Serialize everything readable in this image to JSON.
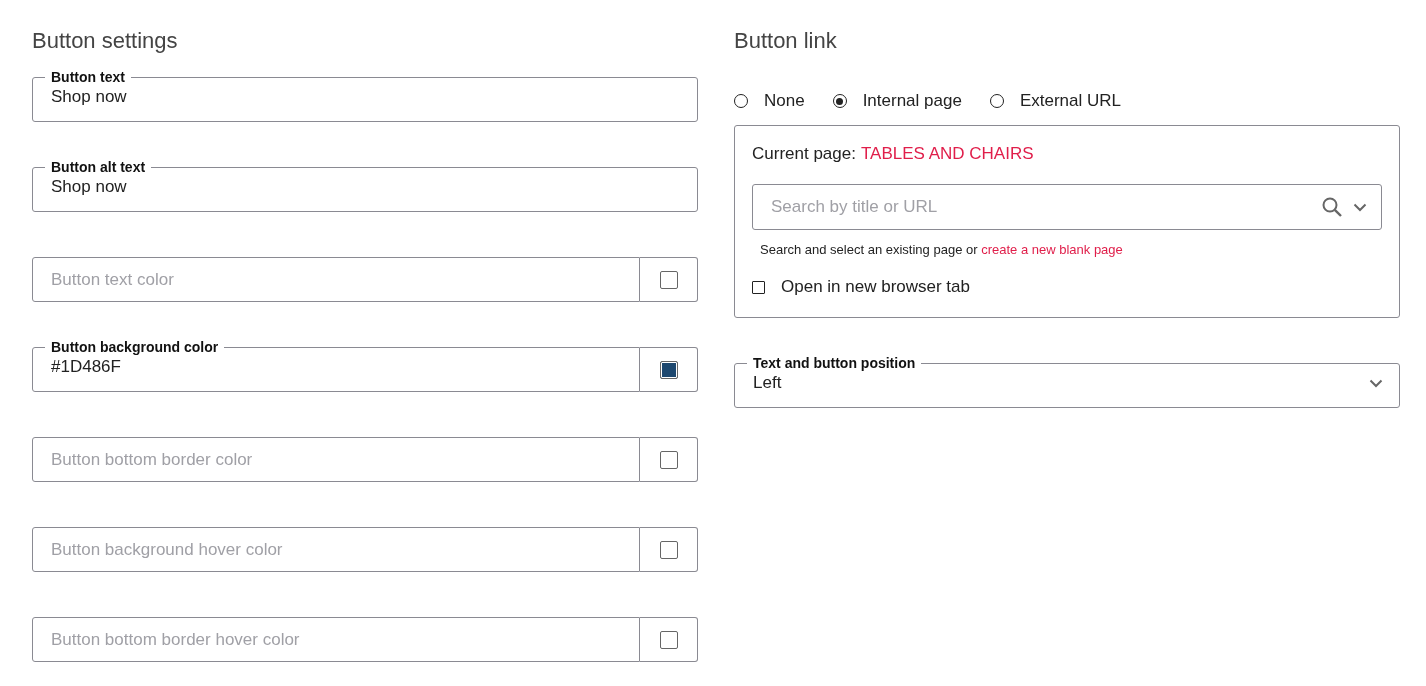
{
  "button_settings": {
    "title": "Button settings",
    "fields": [
      {
        "kind": "text",
        "label": "Button text",
        "value": "Shop now"
      },
      {
        "kind": "text",
        "label": "Button alt text",
        "value": "Shop now"
      },
      {
        "kind": "color",
        "placeholder": "Button text color"
      },
      {
        "kind": "color",
        "label": "Button background color",
        "value": "#1D486F",
        "color": "#1d486f"
      },
      {
        "kind": "color",
        "placeholder": "Button bottom border color"
      },
      {
        "kind": "color",
        "placeholder": "Button background hover color"
      },
      {
        "kind": "color",
        "placeholder": "Button bottom border hover color"
      }
    ]
  },
  "button_link": {
    "title": "Button link",
    "options": [
      {
        "label": "None",
        "selected": false
      },
      {
        "label": "Internal page",
        "selected": true
      },
      {
        "label": "External URL",
        "selected": false
      }
    ],
    "panel": {
      "current_label": "Current page:",
      "current_value": "TABLES AND CHAIRS",
      "search": {
        "placeholder": "Search by title or URL"
      },
      "helper": {
        "text": "Search and select an existing page or",
        "link": "create a new blank page"
      },
      "checkbox": {
        "label": "Open in new browser tab",
        "checked": false
      }
    }
  },
  "position_select": {
    "label": "Text and button position",
    "value": "Left"
  }
}
